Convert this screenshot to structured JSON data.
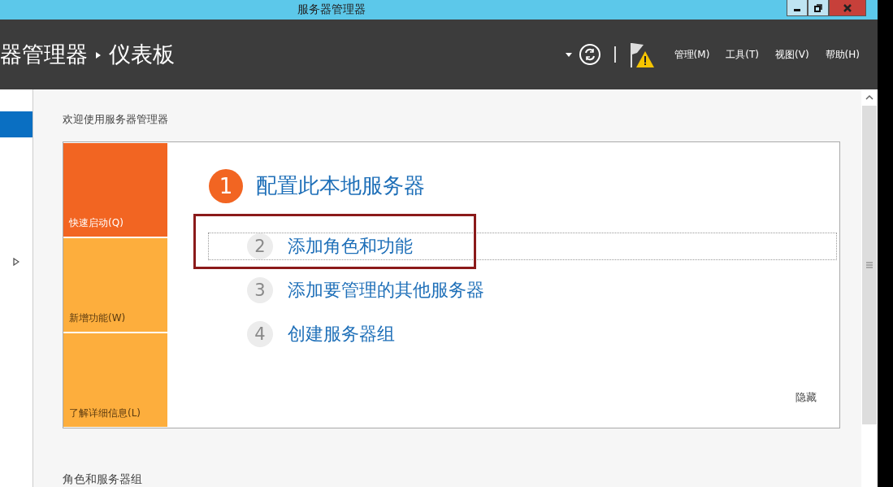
{
  "window": {
    "title": "服务器管理器"
  },
  "header": {
    "breadcrumb": [
      "器管理器",
      "仪表板"
    ],
    "menus": [
      "管理(M)",
      "工具(T)",
      "视图(V)",
      "帮助(H)"
    ]
  },
  "sidebar": {
    "items": [
      {
        "selected": true
      },
      {
        "selected": false
      }
    ]
  },
  "welcome": {
    "heading": "欢迎使用服务器管理器",
    "tiles": [
      {
        "label": "快速启动(Q)",
        "selected": true
      },
      {
        "label": "新增功能(W)",
        "selected": false
      },
      {
        "label": "了解详细信息(L)",
        "selected": false
      }
    ],
    "steps": [
      {
        "number": "1",
        "label": "配置此本地服务器",
        "kind": "current",
        "focused": false
      },
      {
        "number": "2",
        "label": "添加角色和功能",
        "kind": "step",
        "focused": true
      },
      {
        "number": "3",
        "label": "添加要管理的其他服务器",
        "kind": "step",
        "focused": false
      },
      {
        "number": "4",
        "label": "创建服务器组",
        "kind": "step",
        "focused": false
      }
    ],
    "hide_link": "隐藏"
  },
  "section": {
    "heading": "角色和服务器组"
  }
}
